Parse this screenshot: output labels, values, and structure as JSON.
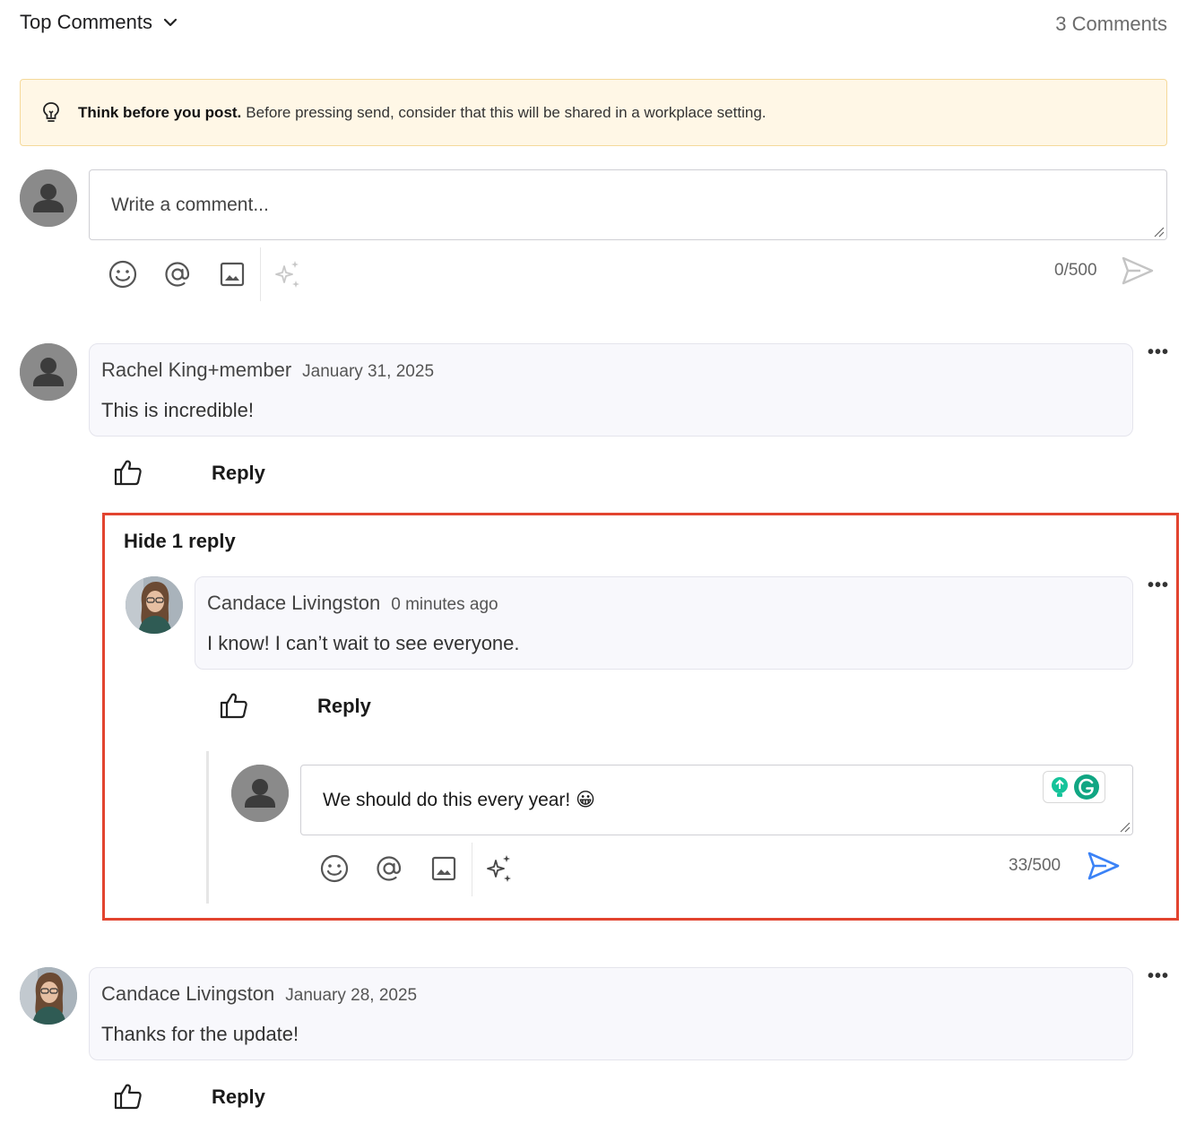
{
  "header": {
    "sort_label": "Top Comments",
    "count_label": "3 Comments"
  },
  "notice": {
    "bold": "Think before you post.",
    "text": "Before pressing send, consider that this will be shared in a workplace setting."
  },
  "composer": {
    "placeholder": "Write a comment...",
    "char_count": "0/500"
  },
  "comments": [
    {
      "author": "Rachel King+member",
      "date": "January 31, 2025",
      "text": "This is incredible!",
      "reply_label": "Reply"
    },
    {
      "author": "Candace Livingston",
      "date": "January 28, 2025",
      "text": "Thanks for the update!",
      "reply_label": "Reply"
    }
  ],
  "replies": {
    "toggle_label": "Hide 1 reply",
    "items": [
      {
        "author": "Candace Livingston",
        "date": "0 minutes ago",
        "text": "I know! I can’t wait to see everyone.",
        "reply_label": "Reply"
      }
    ]
  },
  "reply_composer": {
    "value": "We should do this every year! 😀",
    "char_count": "33/500"
  },
  "colors": {
    "accent": "#3b82f6",
    "highlight": "#e2442f",
    "notice_bg": "#fff7e6"
  }
}
